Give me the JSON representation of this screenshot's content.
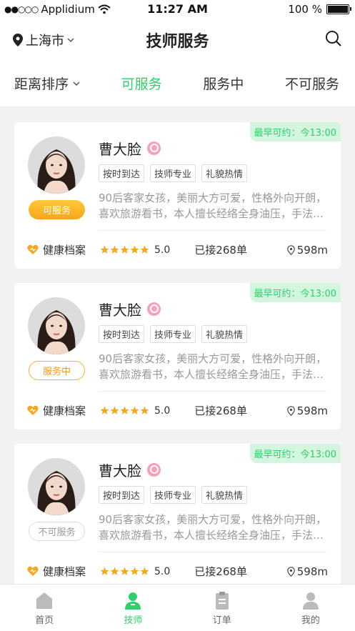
{
  "status_bar": {
    "carrier": "Applidium",
    "time": "11:27 AM",
    "battery": "100 %"
  },
  "header": {
    "city": "上海市",
    "title": "技师服务"
  },
  "filters": {
    "sort": "距离排序",
    "available": "可服务",
    "in_service": "服务中",
    "unavailable": "不可服务"
  },
  "cards": [
    {
      "earliest": "最早可约：今13:00",
      "name": "曹大脸",
      "status": "可服务",
      "status_kind": "available",
      "tags": [
        "按时到达",
        "技师专业",
        "礼貌热情"
      ],
      "desc1": "90后客家女孩，美丽大方可爱，性格外向开朗，",
      "desc2": "喜欢旅游看书，本人擅长经络全身油压，手法…",
      "health": "健康档案",
      "rating": "5.0",
      "orders": "已接268单",
      "distance": "598m"
    },
    {
      "earliest": "最早可约：今13:00",
      "name": "曹大脸",
      "status": "服务中",
      "status_kind": "busy",
      "tags": [
        "按时到达",
        "技师专业",
        "礼貌热情"
      ],
      "desc1": "90后客家女孩，美丽大方可爱，性格外向开朗，",
      "desc2": "喜欢旅游看书，本人擅长经络全身油压，手法…",
      "health": "健康档案",
      "rating": "5.0",
      "orders": "已接268单",
      "distance": "598m"
    },
    {
      "earliest": "最早可约：今13:00",
      "name": "曹大脸",
      "status": "不可服务",
      "status_kind": "off",
      "tags": [
        "按时到达",
        "技师专业",
        "礼貌热情"
      ],
      "desc1": "90后客家女孩，美丽大方可爱，性格外向开朗，",
      "desc2": "喜欢旅游看书，本人擅长经络全身油压，手法…",
      "health": "健康档案",
      "rating": "5.0",
      "orders": "已接268单",
      "distance": "598m"
    }
  ],
  "tabbar": {
    "home": "首页",
    "tech": "技师",
    "orders": "订单",
    "mine": "我的"
  },
  "colors": {
    "accent": "#2fcf6a",
    "orange": "#f7a51b"
  }
}
